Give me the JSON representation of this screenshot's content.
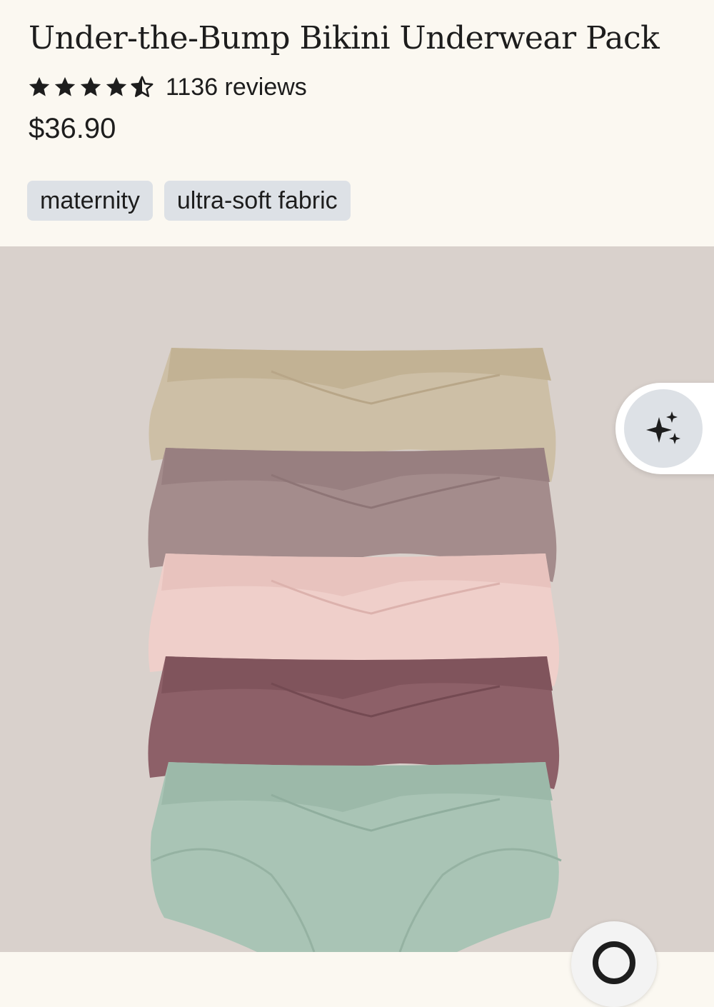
{
  "product": {
    "title": "Under-the-Bump Bikini Underwear Pack",
    "rating": 4.5,
    "rating_max": 5,
    "reviews_label": "1136 reviews",
    "price": "$36.90",
    "tags": [
      "maternity",
      "ultra-soft fabric"
    ]
  },
  "image": {
    "description_icon": "product-photo",
    "background_color": "#d9d1cc",
    "garment_colors": [
      "#cdbfa6",
      "#a48c8c",
      "#efcfca",
      "#8d6068",
      "#a9c4b5"
    ]
  },
  "controls": {
    "ai_button_icon": "sparkles-icon",
    "bottom_button_icon": "search-icon"
  }
}
